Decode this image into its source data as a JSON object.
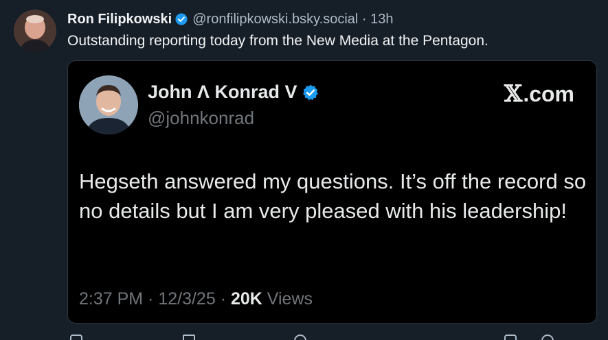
{
  "post": {
    "author_name": "Ron Filipkowski",
    "handle_time": "@ronfilipkowski.bsky.social · 13h",
    "text": "Outstanding reporting today from the New Media at the Pentagon.",
    "verified_color": "#1d9bf0"
  },
  "embed": {
    "author_name": "John Λ Konrad V",
    "handle": "@johnkonrad",
    "source_x": "𝕏",
    "source_rest": ".com",
    "text": "Hegseth answered my questions. It’s off the record so no details but I am very pleased with his leadership!",
    "time_date": "2:37 PM · 12/3/25 · ",
    "views_count": "20K",
    "views_label": " Views",
    "verified_color": "#1d9bf0"
  },
  "actions": [
    {
      "icon": "reply-icon"
    },
    {
      "icon": "repost-icon"
    },
    {
      "icon": "like-icon"
    },
    {
      "icon": "bookmark-icon"
    },
    {
      "icon": "share-icon"
    }
  ]
}
